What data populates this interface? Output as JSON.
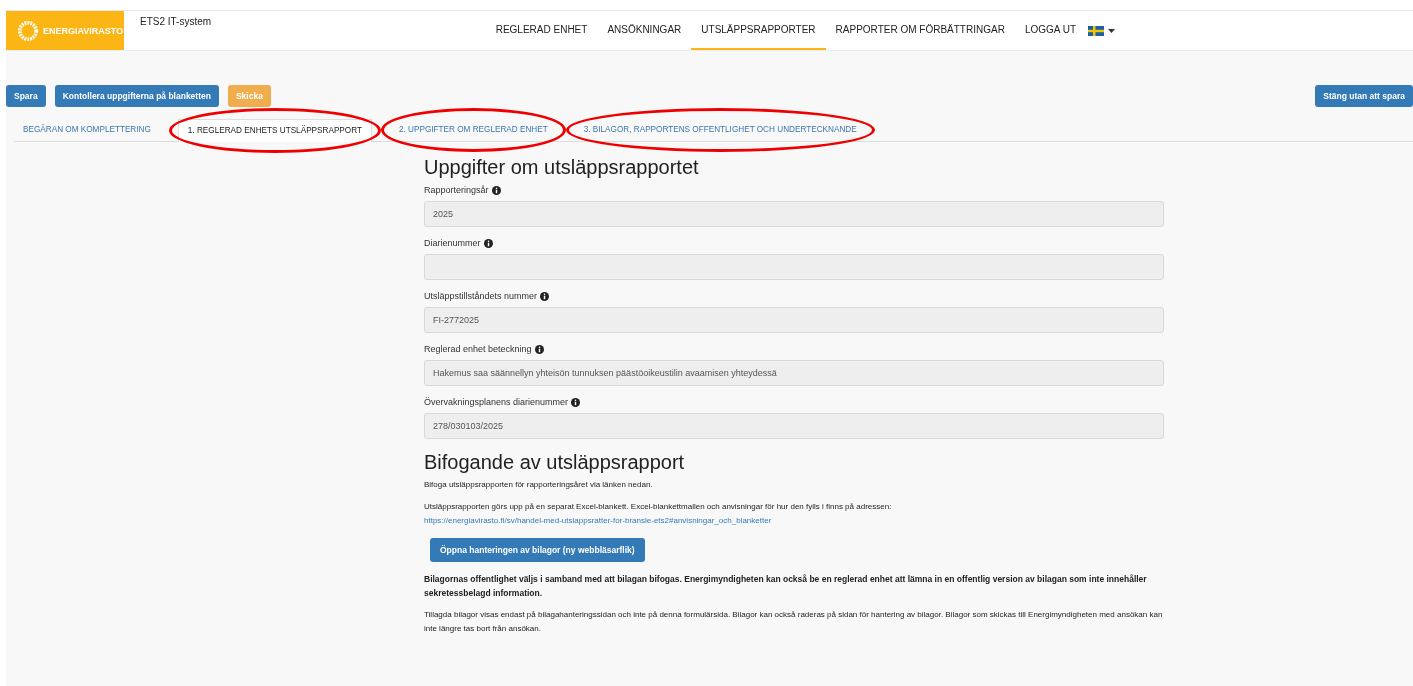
{
  "header": {
    "logo": "ENERGIAVIRASTO",
    "system": "ETS2 IT-system",
    "nav": [
      {
        "label": "REGLERAD ENHET",
        "selected": false
      },
      {
        "label": "ANSÖKNINGAR",
        "selected": false
      },
      {
        "label": "UTSLÄPPSRAPPORTER",
        "selected": true
      },
      {
        "label": "RAPPORTER OM FÖRBÄTTRINGAR",
        "selected": false
      },
      {
        "label": "LOGGA UT",
        "selected": false
      }
    ]
  },
  "toolbar": {
    "buttons": [
      {
        "label": "Spara",
        "kind": "primary"
      },
      {
        "label": "Kontollera uppgifterna på blanketten",
        "kind": "primary"
      },
      {
        "label": "Skicka",
        "kind": "warning"
      }
    ],
    "close_button": "Stäng utan att spara"
  },
  "tabs": [
    {
      "label": "BEGÄRAN OM KOMPLETTERING",
      "selected": false,
      "circled": false
    },
    {
      "label": "1. REGLERAD ENHETS UTSLÄPPSRAPPORT",
      "selected": true,
      "circled": true
    },
    {
      "label": "2. UPPGIFTER OM REGLERAD ENHET",
      "selected": false,
      "circled": true
    },
    {
      "label": "3. BILAGOR, RAPPORTENS OFFENTLIGHET OCH UNDERTECKNANDE",
      "selected": false,
      "circled": true
    }
  ],
  "report_section": {
    "title": "Uppgifter om utsläppsrapportet",
    "fields": [
      {
        "label": "Rapporteringsår",
        "value": "2025"
      },
      {
        "label": "Diarienummer"
      },
      {
        "label": "Utsläppstillståndets nummer",
        "value": "FI-2772025"
      },
      {
        "label": "Reglerad enhet beteckning",
        "value": "Hakemus saa säännellyn yhteisön tunnuksen päästöoikeustilin avaamisen yhteydessä"
      },
      {
        "label": "Övervakningsplanens diarienummer",
        "value": "278/030103/2025"
      }
    ]
  },
  "attachment_section": {
    "title": "Bifogande av utsläppsrapport",
    "intro": "Bifoga utsläppsrapporten för rapporteringsåret via länken nedan.",
    "instructions": "Utsläppsrapporten görs upp på en separat Excel-blankett. Excel-blankettmallen och anvisningar för hur den fylls i finns på adressen:",
    "link": "https://energiavirasto.fi/sv/handel-med-utslappsratter-for-bransle-ets2#anvisningar_och_blanketter",
    "button": "Öppna hanteringen av bilagor (ny webbläsarflik)",
    "notice": "Bilagornas offentlighet väljs i samband med att bilagan bifogas. Energimyndigheten kan också be en reglerad enhet att lämna in en offentlig version av bilagan som inte innehåller sekretessbelagd information.",
    "note": "Tillagda bilagor visas endast på bilagahanteringssidan och inte på denna formulärsida. Bilagor kan också raderas på sidan för hantering av bilagor. Bilagor som skickas till Energimyndigheten med ansökan kan inte längre tas bort från ansökan."
  }
}
